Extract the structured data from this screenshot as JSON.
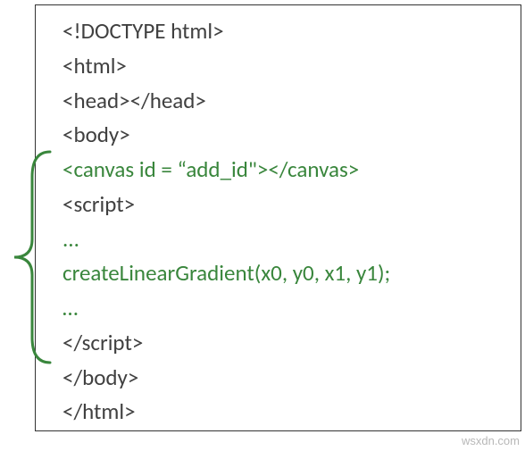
{
  "lines": {
    "l0": "<!DOCTYPE html>",
    "l1": "<html>",
    "l2": "<head></head>",
    "l3": "<body>",
    "l4": "<canvas id = “add_id\"></canvas>",
    "l5": "<script>",
    "l6": " ...",
    "l7": " createLinearGradient(x0, y0, x1, y1);",
    "l8": " …",
    "l9": "</script>",
    "l10": "</body>",
    "l11": "</html>"
  },
  "watermark": "wsxdn.com"
}
